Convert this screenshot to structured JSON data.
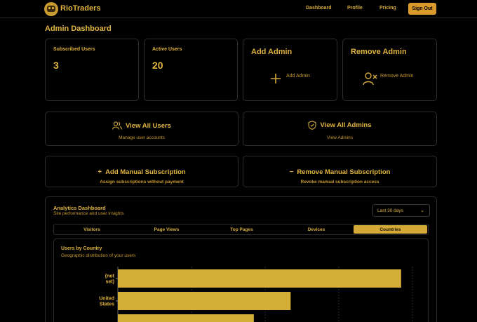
{
  "brand": {
    "name": "RioTraders"
  },
  "nav": {
    "dashboard": "Dashboard",
    "profile": "Profile",
    "pricing": "Pricing",
    "signout": "Sign Out"
  },
  "page": {
    "title": "Admin Dashboard"
  },
  "stats": {
    "subscribed": {
      "label": "Subscribed Users",
      "value": "3"
    },
    "active": {
      "label": "Active Users",
      "value": "20"
    }
  },
  "admin": {
    "add": {
      "title": "Add Admin",
      "action": "Add Admin",
      "icon": "plus-icon"
    },
    "remove": {
      "title": "Remove Admin",
      "action": "Remove Admin",
      "icon": "user-x-icon"
    }
  },
  "cards": {
    "view_users": {
      "title": "View All Users",
      "sub": "Manage user accounts",
      "icon": "users-icon"
    },
    "view_admins": {
      "title": "View All Admins",
      "sub": "View Admins",
      "icon": "shield-check-icon"
    },
    "add_sub": {
      "title": "Add Manual Subscription",
      "sub": "Assign subscriptions without payment",
      "icon": "plus-icon"
    },
    "remove_sub": {
      "title": "Remove Manual Subscription",
      "sub": "Revoke manual subscription access",
      "icon": "minus-icon"
    }
  },
  "analytics": {
    "title": "Analytics Dashboard",
    "subtitle": "Site performance and user insights",
    "range": "Last 30 days",
    "tabs": [
      "Visitors",
      "Page Views",
      "Top Pages",
      "Devices",
      "Countries"
    ],
    "active_tab": "Countries",
    "chart_title": "Users by Country",
    "chart_subtitle": "Geographic distribution of your users"
  },
  "colors": {
    "accent": "#d4a93a",
    "button": "#d99a2b",
    "background": "#000000",
    "border": "#2c2c2c"
  },
  "chart_data": {
    "type": "bar",
    "orientation": "horizontal",
    "title": "Users by Country",
    "subtitle": "Geographic distribution of your users",
    "categories": [
      "(not set)",
      "United States",
      ""
    ],
    "values": [
      100,
      61,
      48
    ],
    "xlim": [
      0,
      104
    ],
    "grid": true
  }
}
